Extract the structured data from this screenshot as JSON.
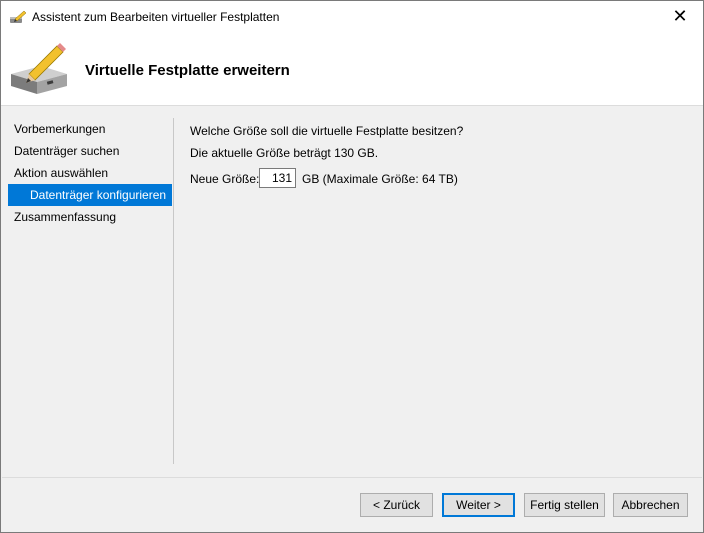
{
  "window": {
    "title": "Assistent zum Bearbeiten virtueller Festplatten",
    "close_glyph": "✕"
  },
  "header": {
    "title": "Virtuelle Festplatte erweitern",
    "icon": "disk-with-pencil-icon"
  },
  "nav": {
    "items": [
      {
        "label": "Vorbemerkungen"
      },
      {
        "label": "Datenträger suchen"
      },
      {
        "label": "Aktion auswählen"
      },
      {
        "label": "Datenträger konfigurieren"
      },
      {
        "label": "Zusammenfassung"
      }
    ]
  },
  "main": {
    "question": "Welche Größe soll die virtuelle Festplatte besitzen?",
    "current_size": "Die aktuelle Größe beträgt 130 GB.",
    "new_size_label": "Neue Größe:",
    "new_size_value": "131",
    "size_hint": "GB (Maximale Größe: 64 TB)"
  },
  "buttons": {
    "back": "< Zurück",
    "next": "Weiter >",
    "finish": "Fertig stellen",
    "cancel": "Abbrechen"
  },
  "colors": {
    "accent": "#0078d7",
    "window_bg": "#f0f0f0",
    "header_bg": "#ffffff"
  }
}
